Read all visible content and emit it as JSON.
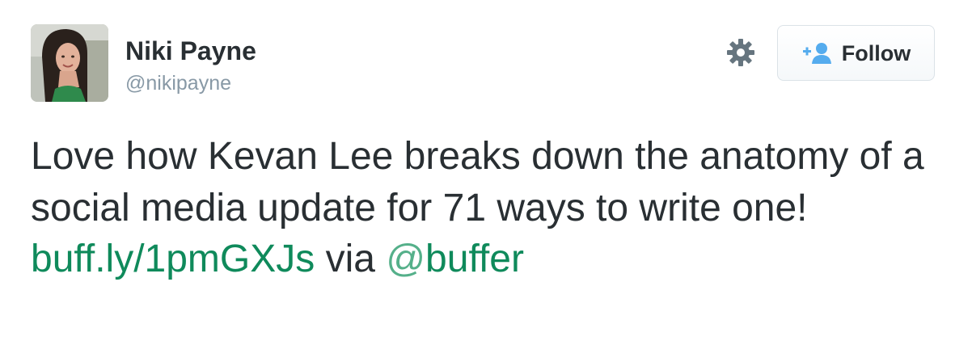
{
  "author": {
    "name": "Niki Payne",
    "handle": "@nikipayne"
  },
  "actions": {
    "settings_icon": "gear-icon",
    "follow_icon": "add-user-icon",
    "follow_label": "Follow"
  },
  "tweet": {
    "text_part1": "Love how Kevan Lee breaks down the anatomy of a social media update for 71 ways to write one!",
    "link": "buff.ly/1pmGXJs",
    "text_part2": "via",
    "mention_at": "@",
    "mention_name": "buffer"
  },
  "colors": {
    "text": "#292f33",
    "handle": "#8899a6",
    "link": "#0f8a5b",
    "follow_icon": "#55acee",
    "gear": "#66757f"
  }
}
